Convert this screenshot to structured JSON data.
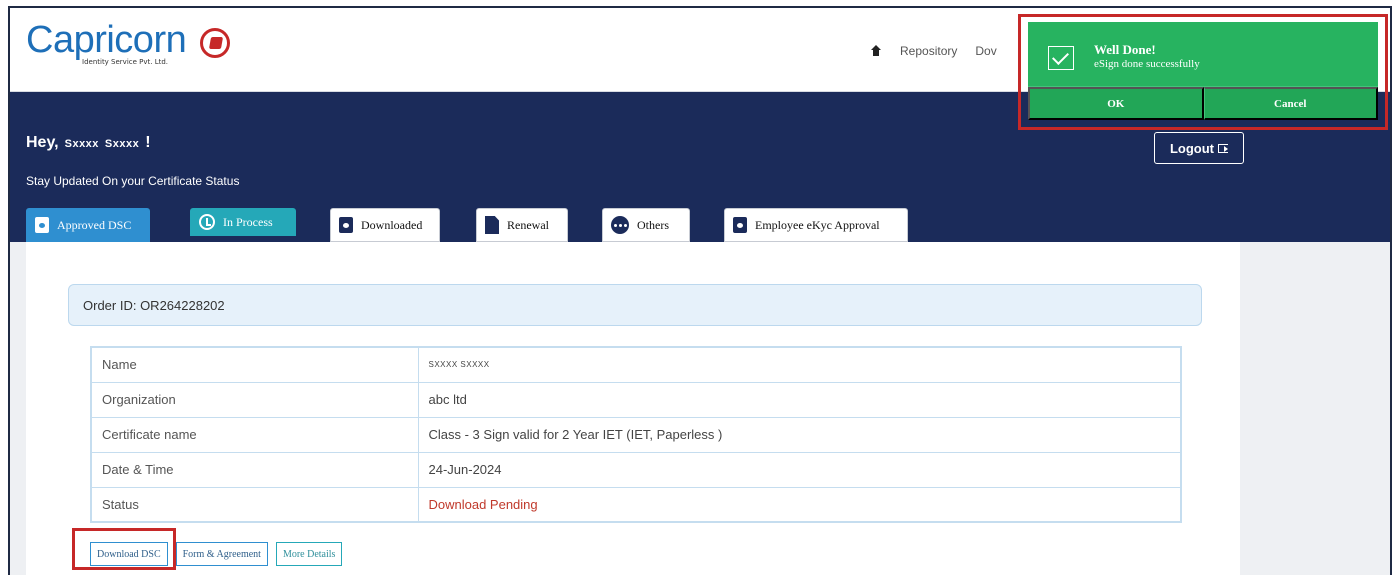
{
  "brand": {
    "name": "Capricorn",
    "subtitle": "Identity Service Pvt. Ltd."
  },
  "nav": {
    "items": [
      "Repository",
      "Dov"
    ]
  },
  "hero": {
    "greeting": "Hey,",
    "first_name": "Sxxxx",
    "last_name": "Sxxxx",
    "exclaim": "!",
    "subline": "Stay Updated On your Certificate Status",
    "logout_label": "Logout"
  },
  "tabs": [
    {
      "label": "Approved DSC",
      "icon": "document-icon",
      "active": true
    },
    {
      "label": "In Process",
      "icon": "clock-check-icon"
    },
    {
      "label": "Downloaded",
      "icon": "document-icon"
    },
    {
      "label": "Renewal",
      "icon": "file-icon"
    },
    {
      "label": "Others",
      "icon": "more-dots-icon"
    },
    {
      "label": "Employee eKyc Approval",
      "icon": "document-icon"
    }
  ],
  "order": {
    "label": "Order ID: OR264228202"
  },
  "details": [
    {
      "key": "Name",
      "value": "SXXXX SXXXX"
    },
    {
      "key": "Organization",
      "value": "abc ltd"
    },
    {
      "key": "Certificate name",
      "value": "Class - 3 Sign valid for 2 Year IET (IET, Paperless )"
    },
    {
      "key": "Date & Time",
      "value": "24-Jun-2024"
    },
    {
      "key": "Status",
      "value": "Download Pending"
    }
  ],
  "actions": {
    "download": "Download DSC",
    "form": "Form & Agreement",
    "more": "More Details"
  },
  "toast": {
    "title": "Well Done!",
    "message": "eSign done successfully",
    "ok_label": "OK",
    "cancel_label": "Cancel"
  },
  "colors": {
    "navy": "#1b2b5a",
    "brand_blue": "#1e6fb8",
    "accent_blue": "#2f8fd0",
    "teal": "#25a8b8",
    "success": "#27b360",
    "danger": "#c62828"
  }
}
